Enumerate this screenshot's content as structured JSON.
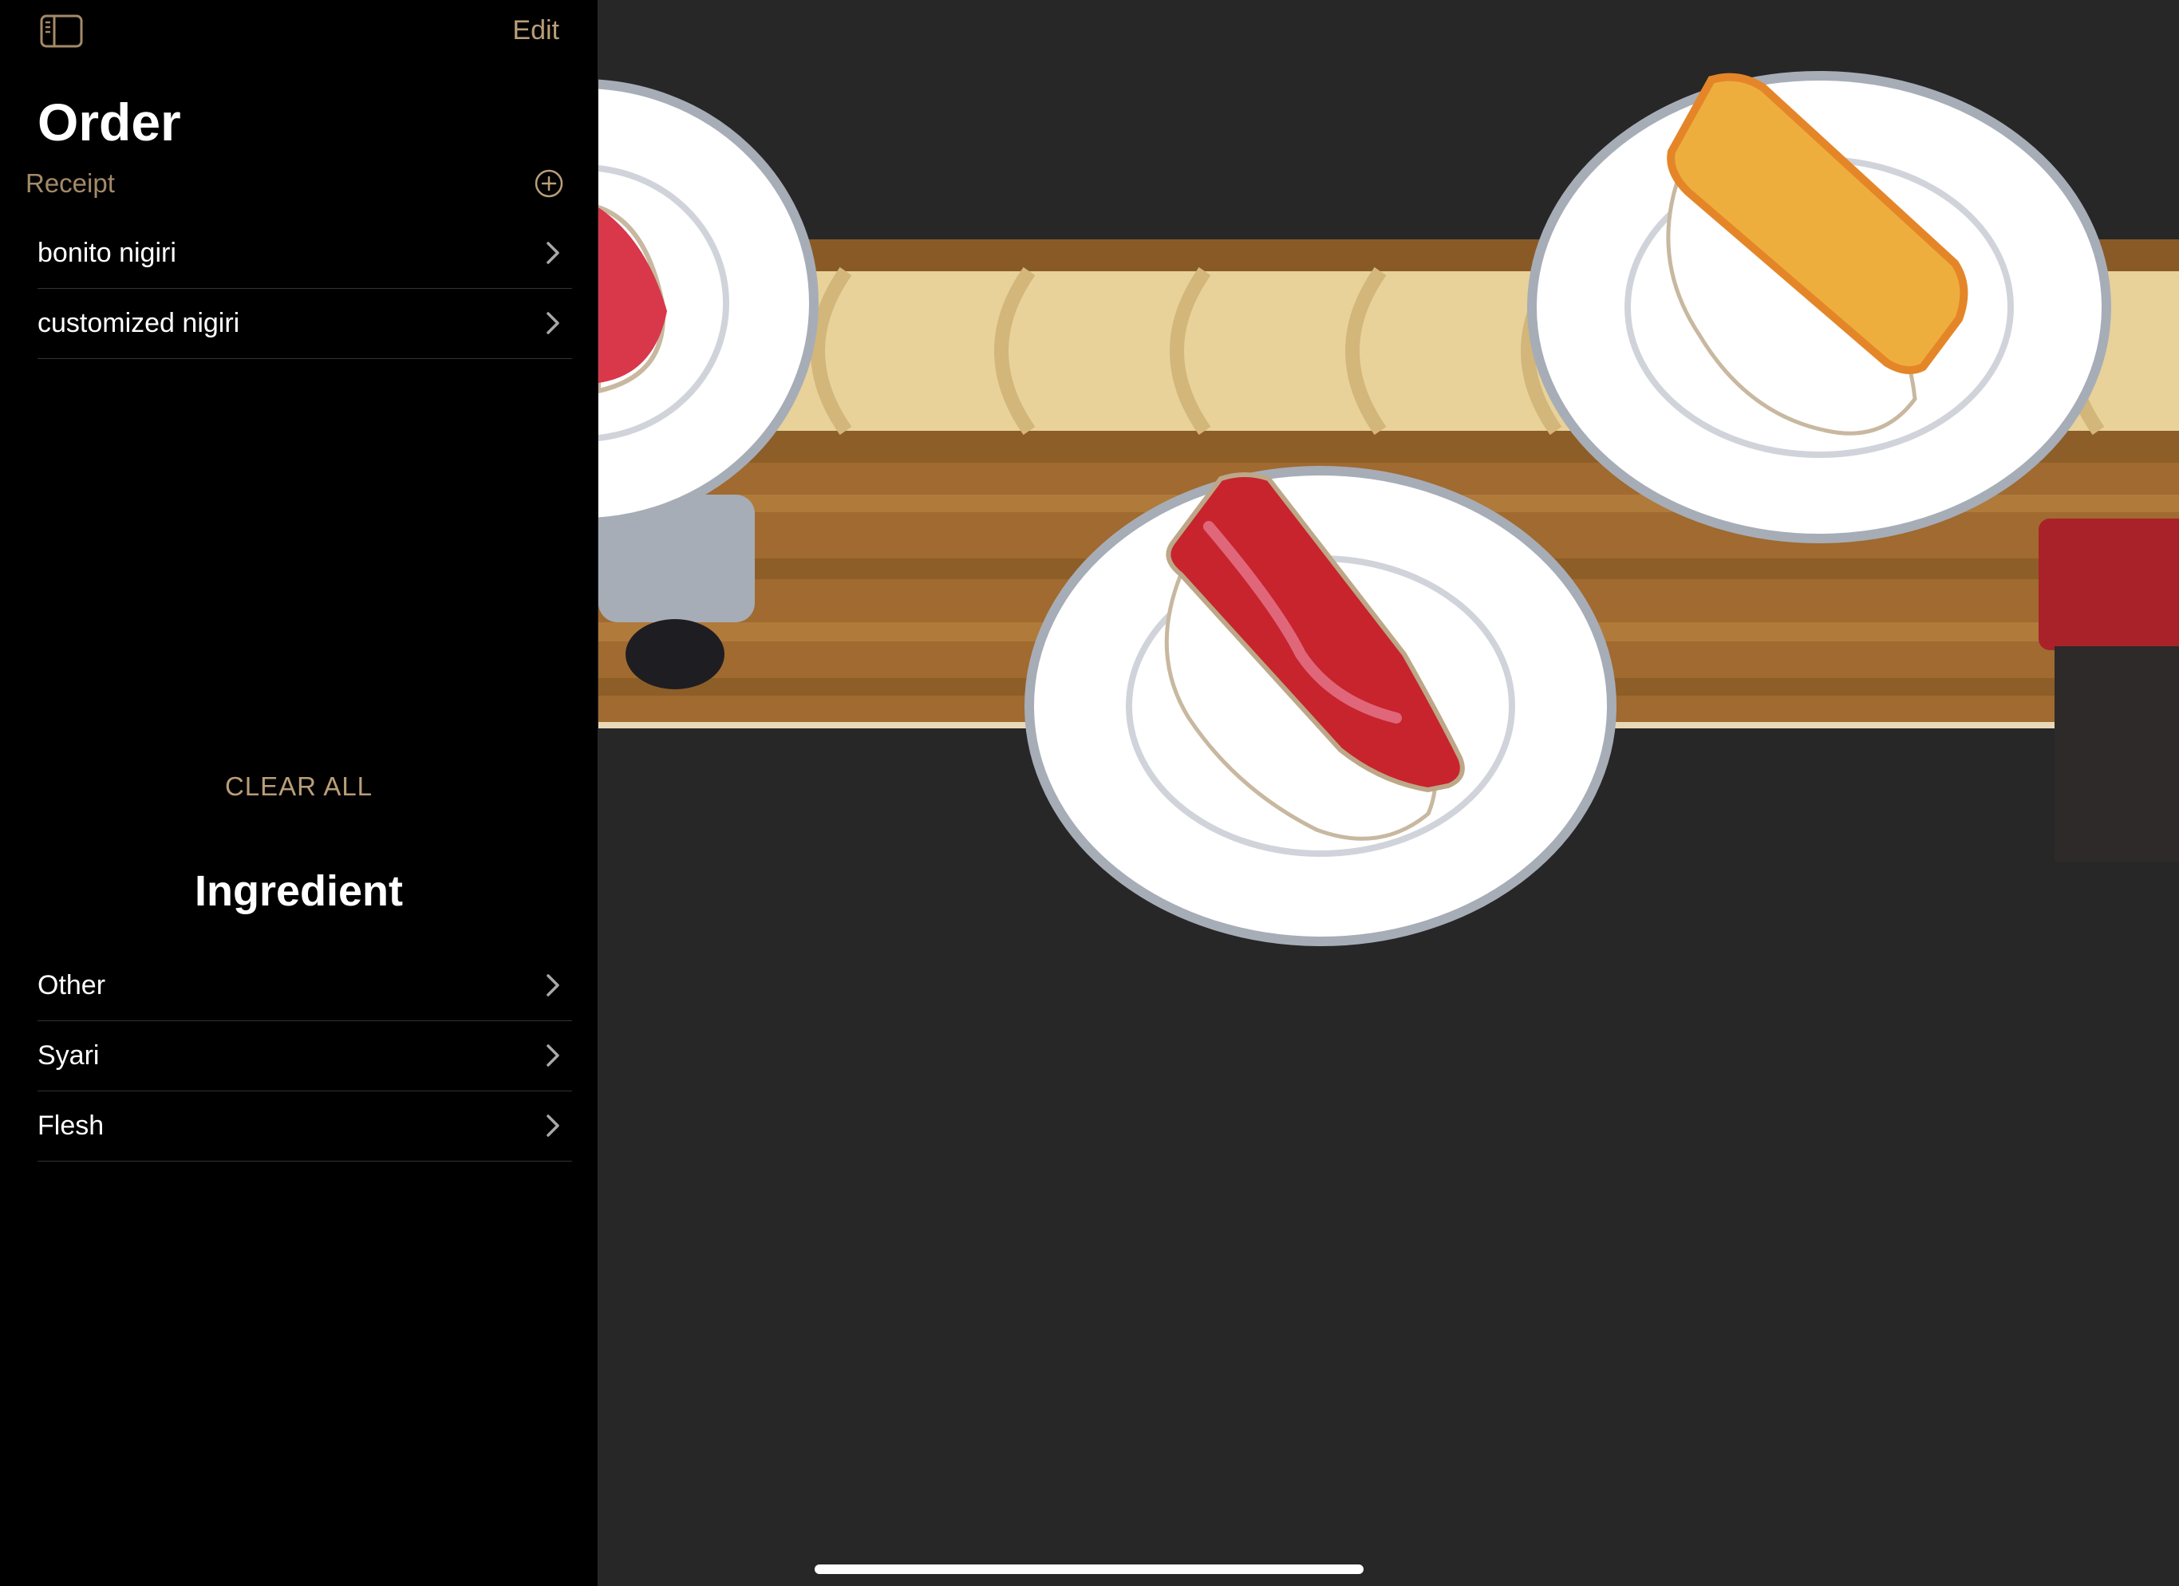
{
  "sidebar": {
    "toggle_icon": "sidebar-toggle-icon",
    "edit_label": "Edit",
    "title": "Order",
    "section_header": "Receipt",
    "add_icon": "plus-circle-icon",
    "receipt_items": [
      {
        "label": "bonito nigiri"
      },
      {
        "label": "customized nigiri"
      }
    ],
    "clear_all_label": "CLEAR ALL",
    "ingredient_title": "Ingredient",
    "ingredient_items": [
      {
        "label": "Other"
      },
      {
        "label": "Syari"
      },
      {
        "label": "Flesh"
      }
    ]
  },
  "detail": {
    "illustration": "sushi conveyor belt illustration"
  },
  "colors": {
    "accent": "#b99e78",
    "section_header": "#a38a67",
    "sidebar_bg": "#000000",
    "detail_bg": "#272727"
  }
}
